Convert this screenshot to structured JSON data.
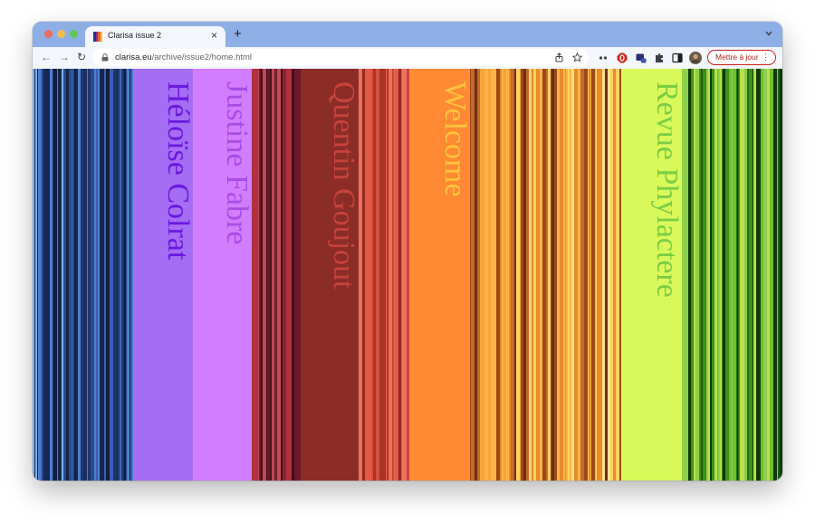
{
  "browser": {
    "tab_title": "Clarisa issue 2",
    "close_glyph": "×",
    "new_tab_glyph": "+",
    "back_glyph": "←",
    "forward_glyph": "→",
    "reload_glyph": "↻",
    "url_domain": "clarisa.eu",
    "url_path": "/archive/issue2/home.html",
    "update_button_label": "Mettre à jour",
    "update_menu_glyph": "⋮"
  },
  "page": {
    "sections": [
      {
        "label": "Héloïse Colrat",
        "bg": "#a56cf4",
        "text_color": "#6a17e0"
      },
      {
        "label": "Justine Fabre",
        "bg": "#d27cff",
        "text_color": "#a24fe6"
      },
      {
        "label": "Quentin Goujout",
        "bg": "#8c2c27",
        "text_color": "#c7433c"
      },
      {
        "label": "Welcome",
        "bg": "#ff8a33",
        "text_color": "#ffc53d"
      },
      {
        "label": "Revue Phylactere",
        "bg": "#d9f95a",
        "text_color": "#7acd45"
      }
    ]
  },
  "icons": {
    "lock": "lock-icon",
    "share": "share-icon",
    "bookmark": "bookmark-star-icon",
    "extensions": "puzzle-icon",
    "side_panel": "side-panel-icon",
    "profile": "profile-avatar-icon"
  }
}
